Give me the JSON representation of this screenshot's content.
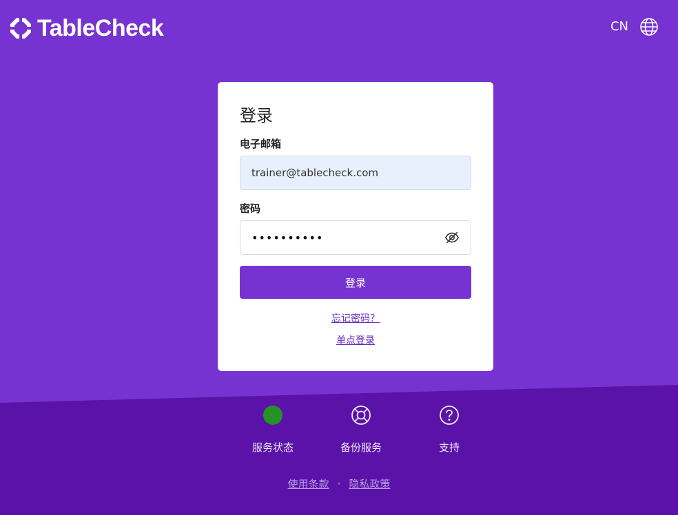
{
  "brand": {
    "name": "TableCheck",
    "logo_icon": "tablecheck-logo-icon"
  },
  "header": {
    "language_code": "CN",
    "language_icon": "globe-icon"
  },
  "login": {
    "title": "登录",
    "email_label": "电子邮箱",
    "email_value": "trainer@tablecheck.com",
    "password_label": "密码",
    "password_value": "••••••••••",
    "password_toggle_icon": "eye-off-icon",
    "submit_label": "登录",
    "forgot_password": "忘记密码？",
    "sso_login": "单点登录"
  },
  "footer": {
    "services": [
      {
        "label": "服务状态",
        "icon": "status-indicator-icon",
        "status_color": "#249225"
      },
      {
        "label": "备份服务",
        "icon": "lifebuoy-icon"
      },
      {
        "label": "支持",
        "icon": "help-circle-icon"
      }
    ],
    "legal": {
      "terms": "使用条款",
      "separator": "·",
      "privacy": "隐私政策"
    }
  },
  "colors": {
    "primary": "#7733d1",
    "footer_band": "#5a12a8",
    "email_field_bg": "#e8f0fd",
    "link": "#6a2cc4"
  }
}
